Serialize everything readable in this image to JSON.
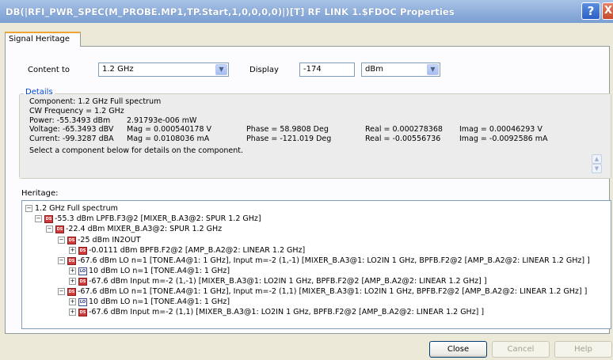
{
  "window": {
    "title": "DB(|RFI_PWR_SPEC(M_PROBE.MP1,TP.Start,1,0,0,0,0)|)[T] RF LINK 1.$FDOC Properties",
    "help_glyph": "?",
    "close_glyph": "X"
  },
  "tabs": [
    {
      "label": "Signal Heritage",
      "active": true
    }
  ],
  "controls": {
    "content_to_label": "Content to",
    "content_to_value": "1.2 GHz",
    "display_label": "Display",
    "display_value": "-174",
    "unit_value": "dBm"
  },
  "details": {
    "legend": "Details",
    "component": "Component: 1.2 GHz Full spectrum",
    "cw_frequency": "CW Frequency =   1.2 GHz",
    "power_label": "Power:   -55.3493 dBm",
    "power_mw": "2.91793e-006 mW",
    "voltage_label": "Voltage: -65.3493 dBV",
    "voltage_mag": "Mag =   0.000540178 V",
    "voltage_phase": "Phase = 58.9808 Deg",
    "voltage_real": "Real =   0.000278368",
    "voltage_imag": "Imag =  0.00046293 V",
    "current_label": "Current: -99.3287 dBA",
    "current_mag": "Mag =   0.0108036 mA",
    "current_phase": "Phase = -121.019 Deg",
    "current_real": "Real =   -0.00556736",
    "current_imag": "Imag =  -0.0092586 mA",
    "hint": "Select a component below for details on the component."
  },
  "heritage": {
    "label": "Heritage:",
    "nodes": [
      {
        "text": "1.2 GHz Full spectrum",
        "icon": "none",
        "expander": "−"
      },
      {
        "text": "-55.3 dBm LPFB.F3@2 [MIXER_B.A3@2: SPUR 1.2 GHz]",
        "icon": "ds-icon",
        "expander": "−"
      },
      {
        "text": "-22.4 dBm MIXER_B.A3@2: SPUR 1.2 GHz",
        "icon": "ds-icon",
        "expander": "−"
      },
      {
        "text": "-25 dBm IN2OUT",
        "icon": "ds-icon",
        "expander": "−"
      },
      {
        "text": "-0.0111 dBm BPFB.F2@2 [AMP_B.A2@2: LINEAR 1.2 GHz]",
        "icon": "ds-icon",
        "expander": "+"
      },
      {
        "text": "-67.6 dBm LO n=1 [TONE.A4@1: 1 GHz], Input m=-2 (1,-1) [MIXER_B.A3@1: LO2IN 1 GHz, BPFB.F2@2 [AMP_B.A2@2: LINEAR 1.2 GHz] ]",
        "icon": "ds-icon",
        "expander": "−"
      },
      {
        "text": "10 dBm LO n=1 [TONE.A4@1: 1 GHz]",
        "icon": "lo-icon",
        "expander": "+"
      },
      {
        "text": "-67.6 dBm Input m=-2 (1,-1) [MIXER_B.A3@1: LO2IN 1 GHz, BPFB.F2@2 [AMP_B.A2@2: LINEAR 1.2 GHz] ]",
        "icon": "ds-icon",
        "expander": "+"
      },
      {
        "text": "-67.6 dBm LO n=1 [TONE.A4@1: 1 GHz], Input m=-2 (1,1) [MIXER_B.A3@1: LO2IN 1 GHz, BPFB.F2@2 [AMP_B.A2@2: LINEAR 1.2 GHz] ]",
        "icon": "ds-icon",
        "expander": "−"
      },
      {
        "text": "10 dBm LO n=1 [TONE.A4@1: 1 GHz]",
        "icon": "lo-icon",
        "expander": "+"
      },
      {
        "text": "-67.6 dBm Input m=-2 (1,1) [MIXER_B.A3@1: LO2IN 1 GHz, BPFB.F2@2 [AMP_B.A2@2: LINEAR 1.2 GHz] ]",
        "icon": "ds-icon",
        "expander": "+"
      }
    ]
  },
  "buttons": {
    "close": "Close",
    "cancel": "Cancel",
    "help": "Help"
  },
  "colors": {
    "title_bar": "#8eaedb",
    "group_legend": "#0046d5",
    "node_icon": "#d03a3a"
  }
}
